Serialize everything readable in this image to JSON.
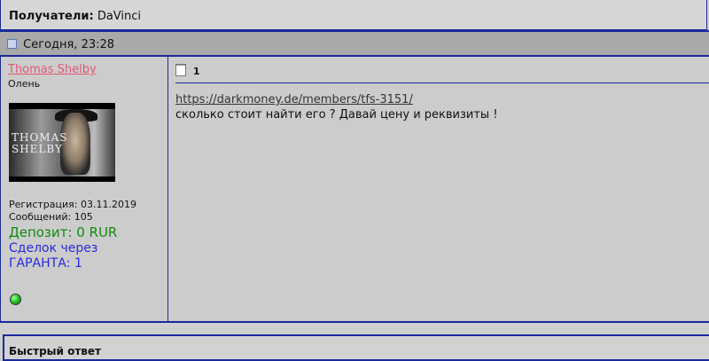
{
  "recipients": {
    "label": "Получатели:",
    "value": "DaVinci"
  },
  "post": {
    "date": "Сегодня, 23:28",
    "user": {
      "name": "Thomas Shelby",
      "title": "Олень",
      "avatar_caption": "THOMAS SHELBY",
      "registration": "Регистрация: 03.11.2019",
      "messages": "Сообщений: 105",
      "deposit": "Депозит: 0 RUR",
      "deals_line1": "Сделок через",
      "deals_line2": "ГАРАНТА: 1",
      "status": "online"
    },
    "message": {
      "number": "1",
      "link": "https://darkmoney.de/members/tfs-3151/",
      "text": "сколько стоит найти его ? Давай цену и реквизиты !"
    }
  },
  "quick_reply": {
    "title": "Быстрый ответ"
  },
  "colors": {
    "border": "#1a2a9a",
    "username": "#e05a7a",
    "deposit": "#118a11",
    "guarantee": "#2a2ae0"
  }
}
